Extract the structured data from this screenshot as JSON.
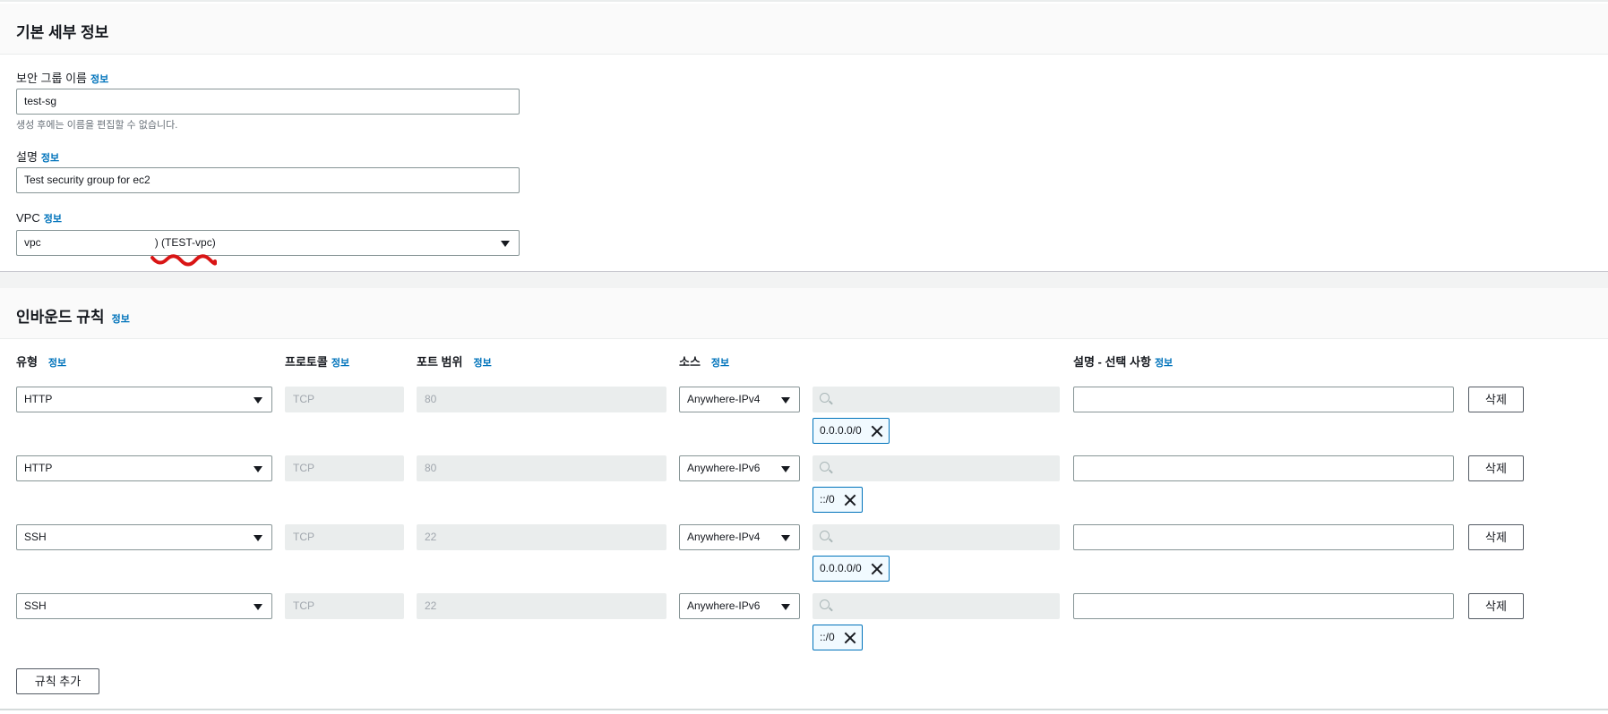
{
  "basic": {
    "title": "기본 세부 정보",
    "sg_name": {
      "label": "보안 그룹 이름",
      "info": "정보",
      "value": "test-sg",
      "hint": "생성 후에는 이름을 편집할 수 없습니다."
    },
    "description": {
      "label": "설명",
      "info": "정보",
      "value": "Test security group for ec2"
    },
    "vpc": {
      "label": "VPC",
      "info": "정보",
      "value_prefix": "vpc",
      "value_suffix": ") (TEST-vpc)"
    }
  },
  "inbound": {
    "title": "인바운드 규칙",
    "info": "정보",
    "headers": {
      "type": "유형",
      "protocol": "프로토콜",
      "port": "포트 범위",
      "source": "소스",
      "desc": "설명 - 선택 사항",
      "info": "정보"
    },
    "rules": [
      {
        "type": "HTTP",
        "protocol": "TCP",
        "port": "80",
        "source": "Anywhere-IPv4",
        "cidr": "0.0.0.0/0",
        "description": "",
        "delete": "삭제"
      },
      {
        "type": "HTTP",
        "protocol": "TCP",
        "port": "80",
        "source": "Anywhere-IPv6",
        "cidr": "::/0",
        "description": "",
        "delete": "삭제"
      },
      {
        "type": "SSH",
        "protocol": "TCP",
        "port": "22",
        "source": "Anywhere-IPv4",
        "cidr": "0.0.0.0/0",
        "description": "",
        "delete": "삭제"
      },
      {
        "type": "SSH",
        "protocol": "TCP",
        "port": "22",
        "source": "Anywhere-IPv6",
        "cidr": "::/0",
        "description": "",
        "delete": "삭제"
      }
    ],
    "add_rule": "규칙 추가"
  },
  "colors": {
    "link": "#0073bb",
    "border": "#879596",
    "disabled_bg": "#eaeded",
    "token_border": "#0073bb",
    "squiggle": "#d91515"
  },
  "icons": {
    "search": "search-icon",
    "dropdown": "caret-down-icon",
    "remove": "close-icon"
  }
}
